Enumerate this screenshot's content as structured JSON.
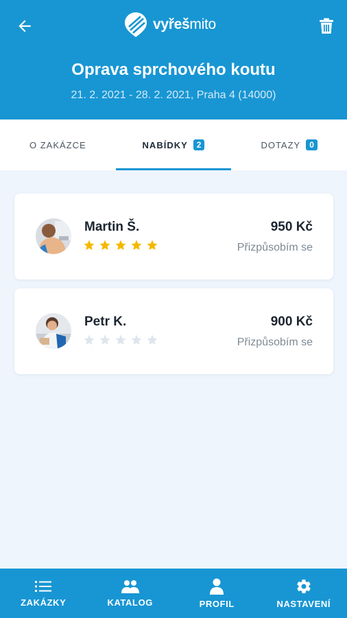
{
  "header": {
    "logo_text_bold": "vyřeš",
    "logo_text_thin": "mito",
    "title": "Oprava sprchového koutu",
    "meta": "21. 2. 2021 - 28. 2. 2021, Praha 4 (14000)",
    "back_icon": "arrow-left-icon",
    "delete_icon": "trash-icon"
  },
  "tabs": [
    {
      "label": "O ZAKÁZCE",
      "badge": null,
      "active": false
    },
    {
      "label": "NABÍDKY",
      "badge": "2",
      "active": true
    },
    {
      "label": "DOTAZY",
      "badge": "0",
      "active": false
    }
  ],
  "offers": [
    {
      "name": "Martin Š.",
      "price": "950 Kč",
      "note": "Přizpůsobím se",
      "rating": 5,
      "max_rating": 5
    },
    {
      "name": "Petr K.",
      "price": "900 Kč",
      "note": "Přizpůsobím se",
      "rating": 0,
      "max_rating": 5
    }
  ],
  "bottom_nav": [
    {
      "label": "ZAKÁZKY",
      "icon": "list-icon"
    },
    {
      "label": "KATALOG",
      "icon": "people-icon"
    },
    {
      "label": "PROFIL",
      "icon": "person-icon"
    },
    {
      "label": "NASTAVENÍ",
      "icon": "gear-icon"
    }
  ],
  "colors": {
    "primary": "#1896d3",
    "background": "#eef5fc",
    "star_filled": "#f5b800",
    "star_empty": "#dde6ee"
  }
}
